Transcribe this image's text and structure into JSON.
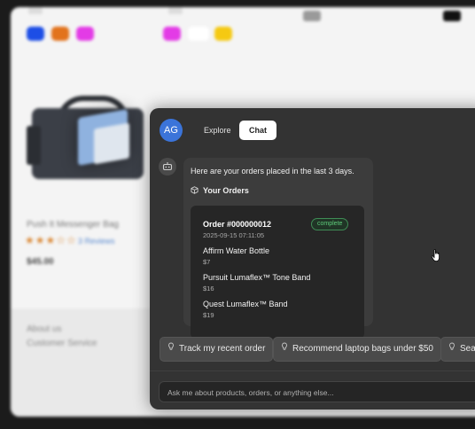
{
  "store": {
    "product_name": "Push It Messenger Bag",
    "stars": "★★★☆☆",
    "reviews_label": "3 Reviews",
    "price": "$45.00",
    "footer_links": [
      "About us",
      "Customer Service"
    ],
    "swatch_colors": [
      "#1d4ee6",
      "#e2731c",
      "#e33be6",
      "#e33be6",
      "#ffffff",
      "#f5c912"
    ]
  },
  "chat": {
    "avatar_initials": "AG",
    "tabs": [
      {
        "label": "Explore",
        "active": false
      },
      {
        "label": "Chat",
        "active": true
      }
    ],
    "message_intro": "Here are your orders placed in the last 3 days.",
    "orders_heading": "Your Orders",
    "order": {
      "number": "Order #000000012",
      "datetime": "2025-09-15 07:11:05",
      "status": "complete",
      "items": [
        {
          "name": "Affirm Water Bottle",
          "price": "$7"
        },
        {
          "name": "Pursuit Lumaflex™ Tone Band",
          "price": "$16"
        },
        {
          "name": "Quest Lumaflex™ Band",
          "price": "$19"
        }
      ]
    },
    "suggestions": [
      {
        "label": "Track my recent order",
        "icon": "lightbulb-icon"
      },
      {
        "label": "Recommend laptop bags under $50",
        "icon": "lightbulb-icon"
      },
      {
        "label": "Sear",
        "icon": "lightbulb-icon"
      }
    ],
    "input_placeholder": "Ask me about products, orders, or anything else..."
  }
}
